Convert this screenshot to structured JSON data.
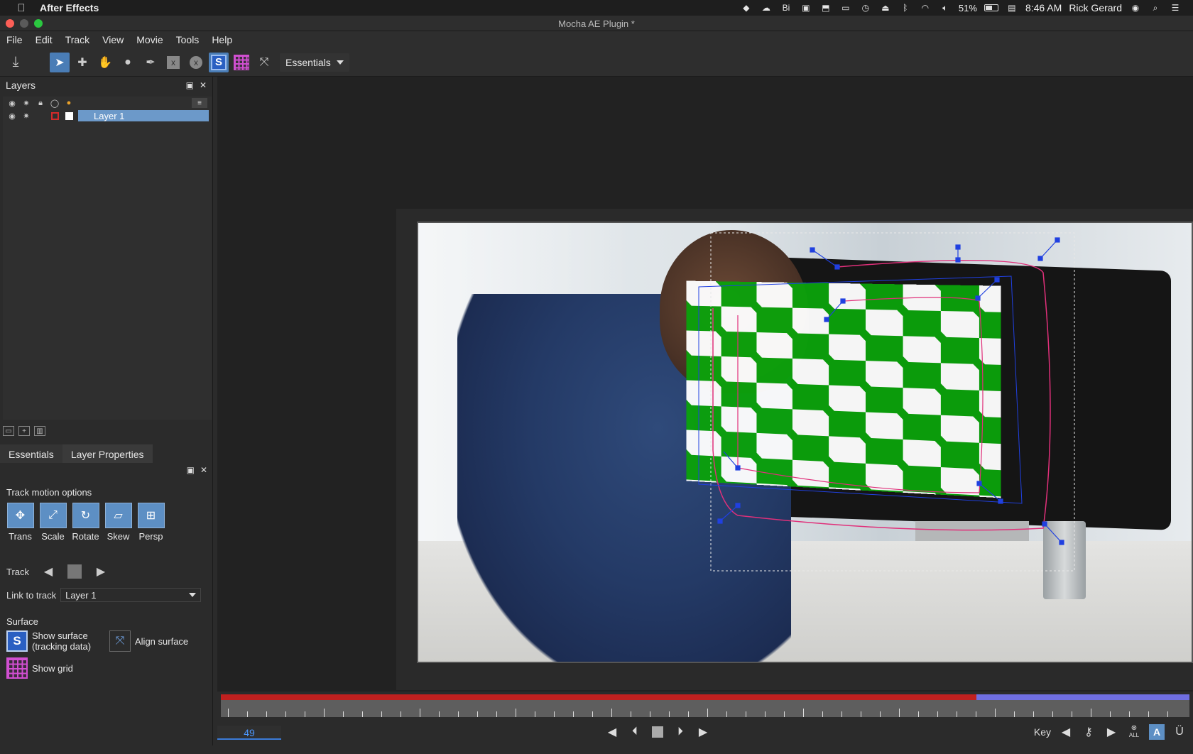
{
  "mac_menubar": {
    "app_name": "After Effects",
    "battery": "51%",
    "clock": "8:46 AM",
    "user": "Rick Gerard"
  },
  "window": {
    "title": "Mocha AE Plugin *"
  },
  "menu": [
    "File",
    "Edit",
    "Track",
    "View",
    "Movie",
    "Tools",
    "Help"
  ],
  "toolbar": {
    "workspace": "Essentials"
  },
  "layers_panel": {
    "title": "Layers",
    "layers": [
      {
        "name": "Layer 1",
        "selected": true
      }
    ]
  },
  "tabs": [
    {
      "label": "Essentials",
      "active": true
    },
    {
      "label": "Layer Properties",
      "active": false
    }
  ],
  "essentials": {
    "motion_title": "Track motion options",
    "motion_buttons": [
      "Trans",
      "Scale",
      "Rotate",
      "Skew",
      "Persp"
    ],
    "track_label": "Track",
    "link_label": "Link to track",
    "link_value": "Layer 1",
    "surface_title": "Surface",
    "show_surface": "Show surface",
    "show_surface_sub": "(tracking data)",
    "align_surface": "Align surface",
    "show_grid": "Show grid"
  },
  "timeline": {
    "current_frame": "49",
    "key_label": "Key",
    "all_label": "ALL"
  },
  "colors": {
    "accent": "#5d8fc4",
    "selection": "#6c99c9",
    "track_range": "#c0201f",
    "track_range_end": "#6f6ee0",
    "spline": "#e0307a",
    "handles": "#2040e0"
  }
}
